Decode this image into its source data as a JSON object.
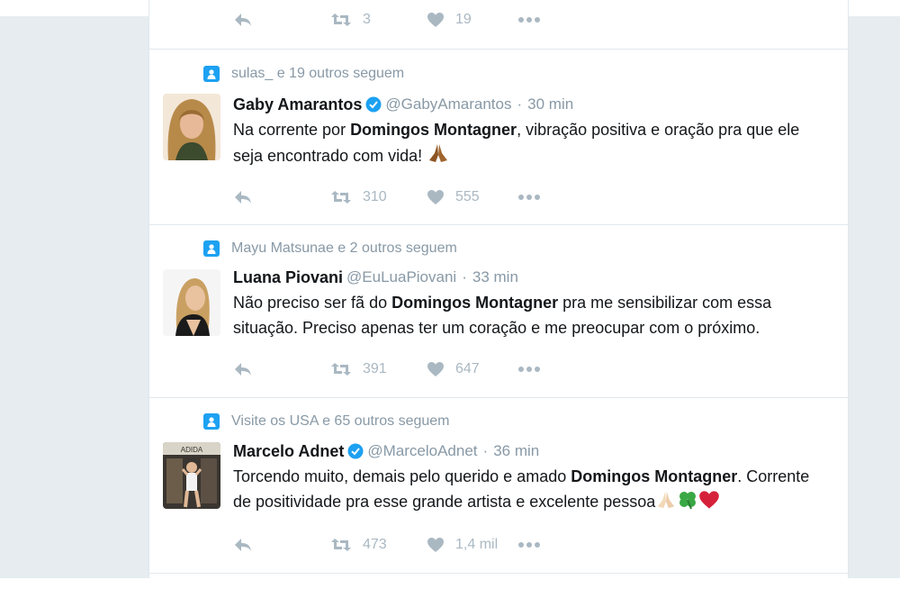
{
  "top_partial": {
    "retweets": "3",
    "likes": "19"
  },
  "tweets": [
    {
      "context": "sulas_ e 19 outros seguem",
      "name": "Gaby Amarantos",
      "verified": true,
      "handle": "@GabyAmarantos",
      "separator": "·",
      "time": "30 min",
      "text_parts": [
        "Na corrente por ",
        "Domingos Montagner",
        ", vibração positiva e oração pra que ele seja encontrado com vida! "
      ],
      "emoji": [
        "praying-hands"
      ],
      "retweets": "310",
      "likes": "555"
    },
    {
      "context": "Mayu Matsunae e 2 outros seguem",
      "name": "Luana Piovani",
      "verified": false,
      "handle": "@EuLuaPiovani",
      "separator": "·",
      "time": "33 min",
      "text_parts": [
        "Não preciso ser fã do ",
        "Domingos Montagner",
        " pra me sensibilizar com essa situação. Preciso apenas ter um coração e me preocupar com o próximo."
      ],
      "emoji": [],
      "retweets": "391",
      "likes": "647"
    },
    {
      "context": "Visite os USA e 65 outros seguem",
      "name": "Marcelo Adnet",
      "verified": true,
      "handle": "@MarceloAdnet",
      "separator": "·",
      "time": "36 min",
      "text_parts": [
        "Torcendo muito, demais pelo querido e amado ",
        "Domingos Montagner",
        ". Corrente de positividade pra esse grande artista e excelente pessoa"
      ],
      "emoji": [
        "praying-hands",
        "four-leaf-clover",
        "red-heart"
      ],
      "retweets": "473",
      "likes": "1,4 mil"
    }
  ],
  "avatar3_sign": "ADIDA",
  "colors": {
    "accent": "#1da1f2",
    "text": "#14171a",
    "muted": "#8899a6",
    "icon": "#aab8c2",
    "border": "#e1e8ed"
  }
}
